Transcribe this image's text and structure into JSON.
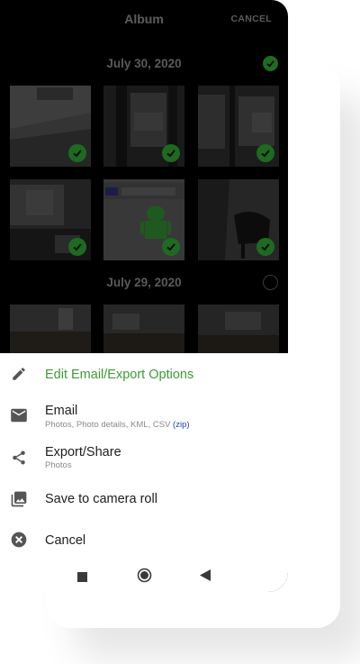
{
  "header": {
    "title": "Album",
    "cancel_label": "CANCEL"
  },
  "sections": [
    {
      "date": "July 30, 2020",
      "selected": true
    },
    {
      "date": "July 29, 2020",
      "selected": false
    }
  ],
  "sheet": {
    "edit_options": "Edit Email/Export Options",
    "email_label": "Email",
    "email_sub": "Photos, Photo details, KML, CSV",
    "email_zip": "(zip)",
    "export_label": "Export/Share",
    "export_sub": "Photos",
    "camera_roll_label": "Save to camera roll",
    "cancel_label": "Cancel"
  },
  "colors": {
    "accent_green": "#3d9b37",
    "check_green": "#1d6a20",
    "zip_blue": "#1a3fb8"
  },
  "icons": [
    "pencil-icon",
    "mail-icon",
    "share-icon",
    "image-icon",
    "cancel-circle-icon",
    "nav-square-icon",
    "nav-home-icon",
    "nav-back-icon"
  ]
}
